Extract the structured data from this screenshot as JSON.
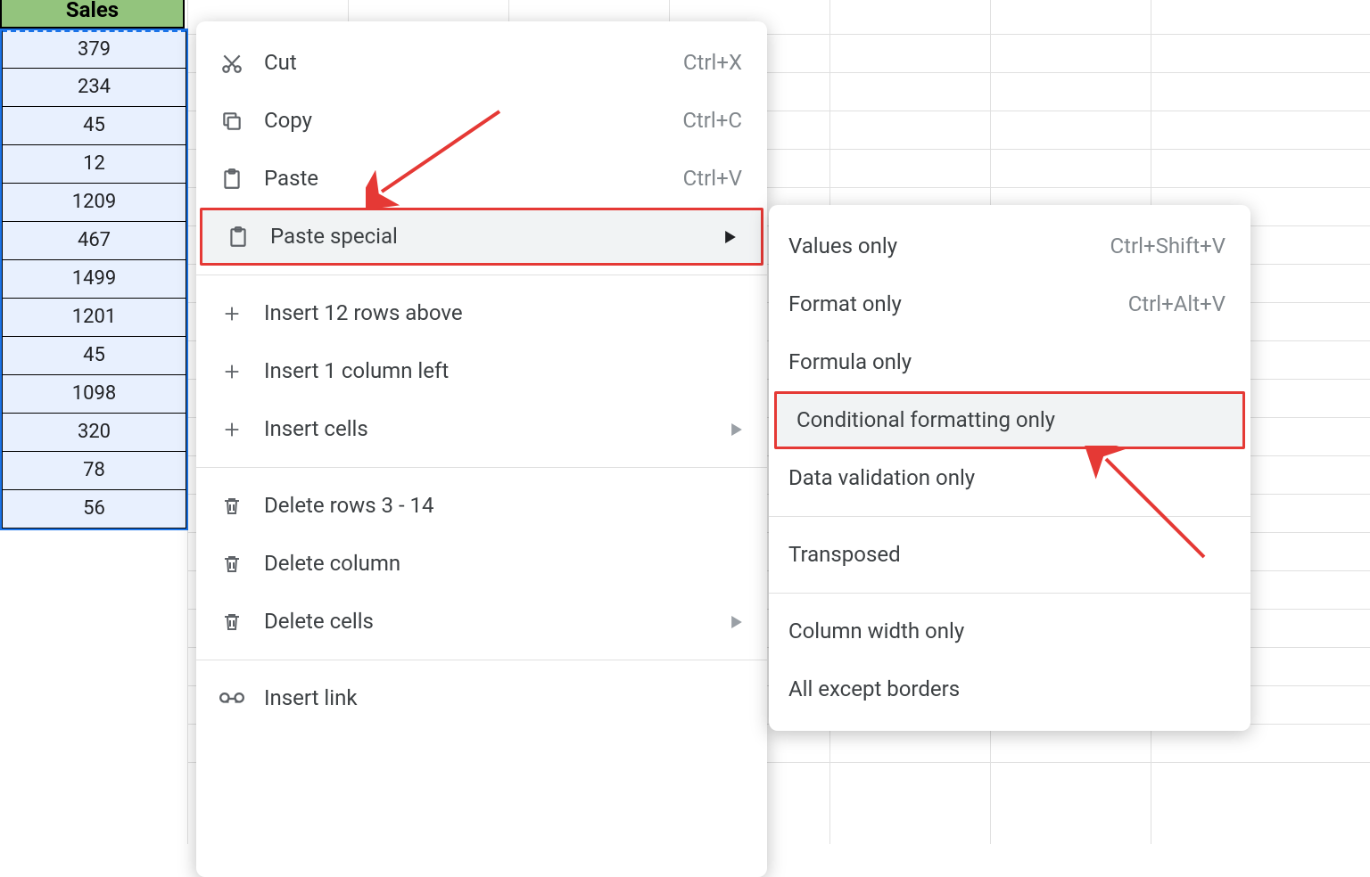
{
  "column_header": "Sales",
  "values": [
    379,
    234,
    45,
    12,
    1209,
    467,
    1499,
    1201,
    45,
    1098,
    320,
    78,
    56
  ],
  "context_menu": {
    "cut": {
      "label": "Cut",
      "shortcut": "Ctrl+X"
    },
    "copy": {
      "label": "Copy",
      "shortcut": "Ctrl+C"
    },
    "paste": {
      "label": "Paste",
      "shortcut": "Ctrl+V"
    },
    "paste_special": {
      "label": "Paste special"
    },
    "insert_rows": {
      "label": "Insert 12 rows above"
    },
    "insert_col": {
      "label": "Insert 1 column left"
    },
    "insert_cells": {
      "label": "Insert cells"
    },
    "delete_rows": {
      "label": "Delete rows 3 - 14"
    },
    "delete_col": {
      "label": "Delete column"
    },
    "delete_cells": {
      "label": "Delete cells"
    },
    "insert_link": {
      "label": "Insert link"
    }
  },
  "paste_special_menu": {
    "values_only": {
      "label": "Values only",
      "shortcut": "Ctrl+Shift+V"
    },
    "format_only": {
      "label": "Format only",
      "shortcut": "Ctrl+Alt+V"
    },
    "formula_only": {
      "label": "Formula only"
    },
    "cond_fmt": {
      "label": "Conditional formatting only"
    },
    "data_val": {
      "label": "Data validation only"
    },
    "transposed": {
      "label": "Transposed"
    },
    "col_width": {
      "label": "Column width only"
    },
    "all_except": {
      "label": "All except borders"
    }
  }
}
